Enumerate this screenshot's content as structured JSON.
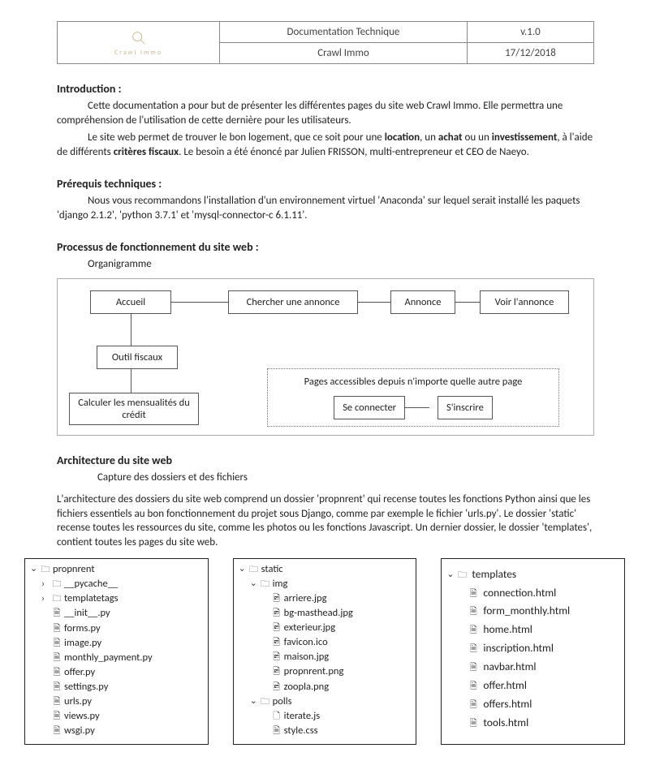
{
  "header": {
    "logo_caption": "Crawl Immo",
    "doc_title": "Documentation Technique",
    "version": "v.1.0",
    "subtitle": "Crawl Immo",
    "date": "17/12/2018"
  },
  "sections": {
    "intro_h": "Introduction :",
    "intro_p1a": "Cette documentation a pour but de présenter les différentes pages du site web Crawl Immo. Elle permettra une compréhension de l'utilisation de cette dernière pour les utilisateurs.",
    "intro_p2a": "Le site web permet de trouver le bon logement, que ce soit pour une ",
    "intro_b1": "location",
    "intro_p2b": ", un ",
    "intro_b2": "achat",
    "intro_p2c": " ou un ",
    "intro_b3": "investissement",
    "intro_p2d": ", à l'aide de différents ",
    "intro_b4": "critères fiscaux",
    "intro_p2e": ". Le besoin a été énoncé par Julien FRISSON, multi-entrepreneur et CEO de Naeyo.",
    "prereq_h": "Prérequis techniques :",
    "prereq_p": "Nous vous recommandons l'installation d'un environnement virtuel 'Anaconda' sur lequel serait installé les paquets 'django 2.1.2', 'python 3.7.1' et 'mysql-connector-c 6.1.11'.",
    "proc_h": "Processus de fonctionnement du site web :",
    "proc_sub": "Organigramme",
    "arch_h": "Architecture du site web",
    "arch_sub": "Capture des dossiers et des fichiers",
    "arch_p": "L'architecture des dossiers du site web comprend un dossier 'propnrent' qui recense toutes les fonctions Python ainsi que les fichiers essentiels au bon fonctionnement du projet sous Django, comme par exemple le fichier 'urls.py'. Le dossier 'static' recense toutes les ressources du site, comme les photos ou les fonctions Javascript. Un dernier dossier, le dossier 'templates', contient toutes les pages du site web."
  },
  "flow": {
    "accueil": "Accueil",
    "chercher": "Chercher une annonce",
    "annonce": "Annonce",
    "voir": "Voir l'annonce",
    "outil": "Outil fiscaux",
    "calc": "Calculer les mensualités du crédit",
    "pages_title": "Pages accessibles depuis n'importe quelle autre page",
    "connect": "Se connecter",
    "inscrire": "S'inscrire"
  },
  "trees": {
    "propnrent": {
      "root": "propnrent",
      "children": [
        "__pycache__",
        "templatetags"
      ],
      "files": [
        "__init__.py",
        "forms.py",
        "image.py",
        "monthly_payment.py",
        "offer.py",
        "settings.py",
        "urls.py",
        "views.py",
        "wsgi.py"
      ]
    },
    "static": {
      "root": "static",
      "img_dir": "img",
      "img_files": [
        "arriere.jpg",
        "bg-masthead.jpg",
        "exterieur.jpg",
        "favicon.ico",
        "maison.jpg",
        "propnrent.png",
        "zoopla.png"
      ],
      "polls_dir": "polls",
      "polls_files": [
        "iterate.js",
        "style.css"
      ]
    },
    "templates": {
      "root": "templates",
      "files": [
        "connection.html",
        "form_monthly.html",
        "home.html",
        "inscription.html",
        "navbar.html",
        "offer.html",
        "offers.html",
        "tools.html"
      ]
    }
  }
}
